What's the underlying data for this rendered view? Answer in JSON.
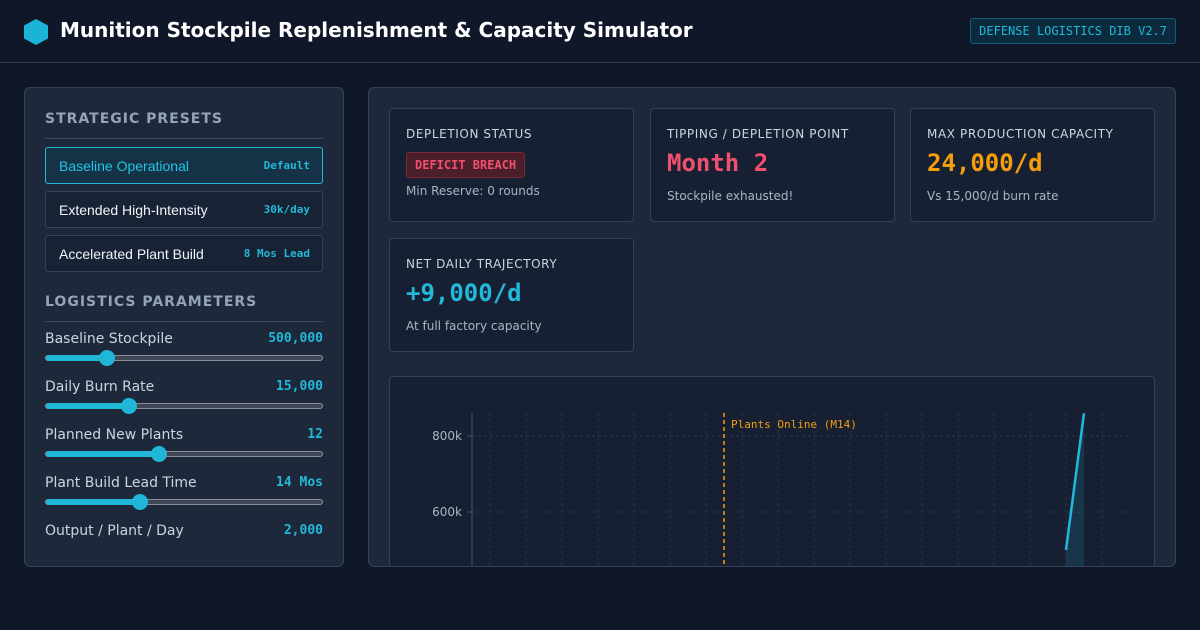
{
  "header": {
    "title": "Munition Stockpile Replenishment & Capacity Simulator",
    "version_badge": "DEFENSE LOGISTICS DIB V2.7",
    "logo_icon": "hexagon-icon",
    "accent_color": "#22b8d8"
  },
  "sidebar": {
    "presets_title": "STRATEGIC PRESETS",
    "presets": [
      {
        "label": "Baseline Operational",
        "tag": "Default",
        "active": true
      },
      {
        "label": "Extended High-Intensity",
        "tag": "30k/day",
        "active": false
      },
      {
        "label": "Accelerated Plant Build",
        "tag": "8 Mos Lead",
        "active": false
      }
    ],
    "params_title": "LOGISTICS PARAMETERS",
    "params": [
      {
        "label": "Baseline Stockpile",
        "value": "500,000",
        "level": 0.22
      },
      {
        "label": "Daily Burn Rate",
        "value": "15,000",
        "level": 0.3
      },
      {
        "label": "Planned New Plants",
        "value": "12",
        "level": 0.41
      },
      {
        "label": "Plant Build Lead Time",
        "value": "14 Mos",
        "level": 0.34
      },
      {
        "label": "Output / Plant / Day",
        "value": "2,000"
      }
    ]
  },
  "cards": {
    "depletion": {
      "title": "DEPLETION STATUS",
      "badge": "DEFICIT BREACH",
      "sub": "Min Reserve: 0 rounds",
      "color": "#f0506e"
    },
    "tipping": {
      "title": "TIPPING / DEPLETION POINT",
      "value": "Month 2",
      "sub": "Stockpile exhausted!",
      "color": "#f0506e"
    },
    "max_capacity": {
      "title": "MAX PRODUCTION CAPACITY",
      "value": "24,000/d",
      "sub": "Vs 15,000/d burn rate",
      "color": "#f59e0b"
    },
    "net_trajectory": {
      "title": "NET DAILY TRAJECTORY",
      "value": "+9,000/d",
      "sub": "At full factory capacity",
      "color": "#22b8d8"
    }
  },
  "chart_data": {
    "type": "line",
    "y_tick_labels": [
      "800k",
      "600k"
    ],
    "y_ticks": [
      800000,
      600000
    ],
    "annotation": {
      "label": "Plants Online (M14)",
      "x": 14,
      "color": "#f59e0b"
    },
    "series": [
      {
        "color": "#22b8d8",
        "points": [
          [
            33,
            500000
          ],
          [
            34,
            860000
          ]
        ]
      }
    ],
    "grid": true
  }
}
